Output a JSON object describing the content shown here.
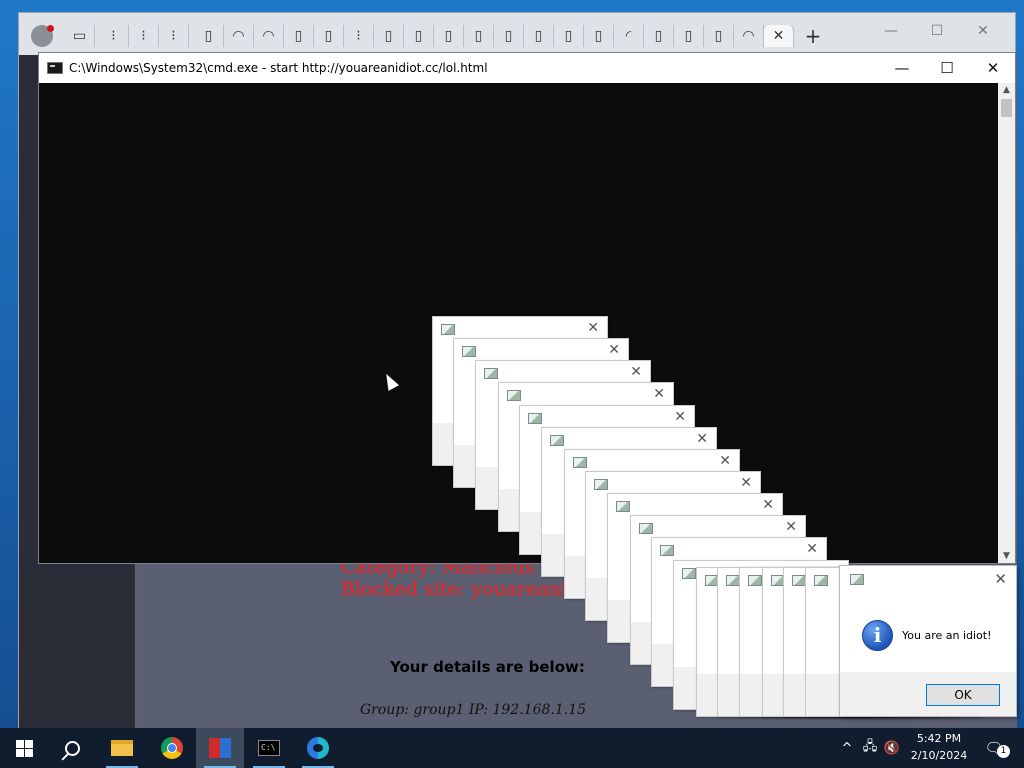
{
  "browser": {
    "new_tab_label": "+",
    "minimize_glyph": "—",
    "maximize_glyph": "☐",
    "close_glyph": "✕",
    "active_tab_close_glyph": "✕"
  },
  "page": {
    "blocked_category": "Category: Malicious w",
    "blocked_site": "Blocked site: youareanidi",
    "details_title": "Your details are below:",
    "details_row": "Group: group1   IP: 192.168.1.15"
  },
  "cmd": {
    "title": "C:\\Windows\\System32\\cmd.exe - start  http://youareanidiot.cc/lol.html",
    "minimize_glyph": "—",
    "maximize_glyph": "☐",
    "close_glyph": "✕"
  },
  "popup": {
    "close_glyph": "✕"
  },
  "dialog": {
    "message": "You are an idiot!",
    "ok_label": "OK",
    "close_glyph": "✕",
    "info_glyph": "i"
  },
  "taskbar": {
    "terminal_glyph": "C:\\",
    "tray_up_glyph": "^",
    "time": "5:42 PM",
    "date": "2/10/2024",
    "notification_count": "1"
  },
  "colors": {
    "blocked_text": "#ff1a1a",
    "info_icon": "#1f55b8",
    "ok_border": "#0078d7"
  }
}
